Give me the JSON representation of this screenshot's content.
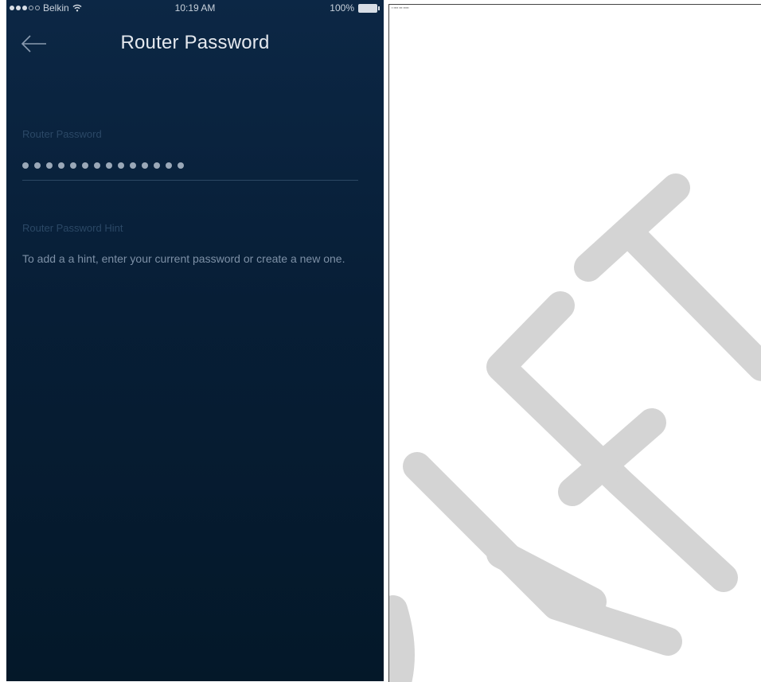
{
  "status_bar": {
    "carrier": "Belkin",
    "time": "10:19 AM",
    "battery": "100%"
  },
  "nav": {
    "title": "Router Password",
    "back_icon": "back-arrow-icon"
  },
  "password_field": {
    "label": "Router Password",
    "masked_length": 14
  },
  "hint_field": {
    "label": "Router Password Hint",
    "text": "To add a a hint, enter your current password or create a new one."
  },
  "draft_page": {
    "watermark": "DRAFT",
    "watermark_color": "#d4d4d4"
  },
  "colors": {
    "background": "#071e36",
    "label": "#2b4866",
    "hint_text": "#7d90a6",
    "title": "#e4e8ee"
  }
}
